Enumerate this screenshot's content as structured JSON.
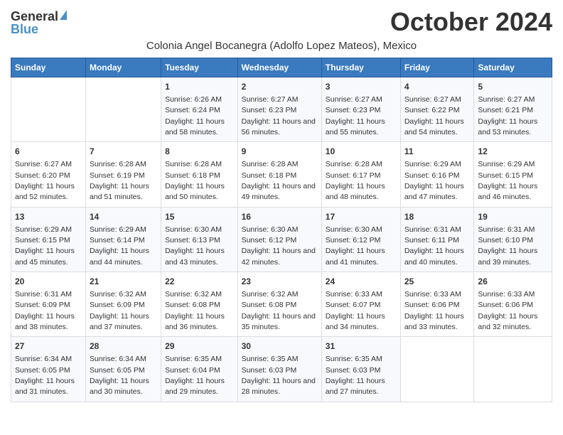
{
  "logo": {
    "general": "General",
    "blue": "Blue"
  },
  "title": "October 2024",
  "subtitle": "Colonia Angel Bocanegra (Adolfo Lopez Mateos), Mexico",
  "days_of_week": [
    "Sunday",
    "Monday",
    "Tuesday",
    "Wednesday",
    "Thursday",
    "Friday",
    "Saturday"
  ],
  "weeks": [
    [
      {
        "day": "",
        "info": ""
      },
      {
        "day": "",
        "info": ""
      },
      {
        "day": "1",
        "info": "Sunrise: 6:26 AM\nSunset: 6:24 PM\nDaylight: 11 hours and 58 minutes."
      },
      {
        "day": "2",
        "info": "Sunrise: 6:27 AM\nSunset: 6:23 PM\nDaylight: 11 hours and 56 minutes."
      },
      {
        "day": "3",
        "info": "Sunrise: 6:27 AM\nSunset: 6:23 PM\nDaylight: 11 hours and 55 minutes."
      },
      {
        "day": "4",
        "info": "Sunrise: 6:27 AM\nSunset: 6:22 PM\nDaylight: 11 hours and 54 minutes."
      },
      {
        "day": "5",
        "info": "Sunrise: 6:27 AM\nSunset: 6:21 PM\nDaylight: 11 hours and 53 minutes."
      }
    ],
    [
      {
        "day": "6",
        "info": "Sunrise: 6:27 AM\nSunset: 6:20 PM\nDaylight: 11 hours and 52 minutes."
      },
      {
        "day": "7",
        "info": "Sunrise: 6:28 AM\nSunset: 6:19 PM\nDaylight: 11 hours and 51 minutes."
      },
      {
        "day": "8",
        "info": "Sunrise: 6:28 AM\nSunset: 6:18 PM\nDaylight: 11 hours and 50 minutes."
      },
      {
        "day": "9",
        "info": "Sunrise: 6:28 AM\nSunset: 6:18 PM\nDaylight: 11 hours and 49 minutes."
      },
      {
        "day": "10",
        "info": "Sunrise: 6:28 AM\nSunset: 6:17 PM\nDaylight: 11 hours and 48 minutes."
      },
      {
        "day": "11",
        "info": "Sunrise: 6:29 AM\nSunset: 6:16 PM\nDaylight: 11 hours and 47 minutes."
      },
      {
        "day": "12",
        "info": "Sunrise: 6:29 AM\nSunset: 6:15 PM\nDaylight: 11 hours and 46 minutes."
      }
    ],
    [
      {
        "day": "13",
        "info": "Sunrise: 6:29 AM\nSunset: 6:15 PM\nDaylight: 11 hours and 45 minutes."
      },
      {
        "day": "14",
        "info": "Sunrise: 6:29 AM\nSunset: 6:14 PM\nDaylight: 11 hours and 44 minutes."
      },
      {
        "day": "15",
        "info": "Sunrise: 6:30 AM\nSunset: 6:13 PM\nDaylight: 11 hours and 43 minutes."
      },
      {
        "day": "16",
        "info": "Sunrise: 6:30 AM\nSunset: 6:12 PM\nDaylight: 11 hours and 42 minutes."
      },
      {
        "day": "17",
        "info": "Sunrise: 6:30 AM\nSunset: 6:12 PM\nDaylight: 11 hours and 41 minutes."
      },
      {
        "day": "18",
        "info": "Sunrise: 6:31 AM\nSunset: 6:11 PM\nDaylight: 11 hours and 40 minutes."
      },
      {
        "day": "19",
        "info": "Sunrise: 6:31 AM\nSunset: 6:10 PM\nDaylight: 11 hours and 39 minutes."
      }
    ],
    [
      {
        "day": "20",
        "info": "Sunrise: 6:31 AM\nSunset: 6:09 PM\nDaylight: 11 hours and 38 minutes."
      },
      {
        "day": "21",
        "info": "Sunrise: 6:32 AM\nSunset: 6:09 PM\nDaylight: 11 hours and 37 minutes."
      },
      {
        "day": "22",
        "info": "Sunrise: 6:32 AM\nSunset: 6:08 PM\nDaylight: 11 hours and 36 minutes."
      },
      {
        "day": "23",
        "info": "Sunrise: 6:32 AM\nSunset: 6:08 PM\nDaylight: 11 hours and 35 minutes."
      },
      {
        "day": "24",
        "info": "Sunrise: 6:33 AM\nSunset: 6:07 PM\nDaylight: 11 hours and 34 minutes."
      },
      {
        "day": "25",
        "info": "Sunrise: 6:33 AM\nSunset: 6:06 PM\nDaylight: 11 hours and 33 minutes."
      },
      {
        "day": "26",
        "info": "Sunrise: 6:33 AM\nSunset: 6:06 PM\nDaylight: 11 hours and 32 minutes."
      }
    ],
    [
      {
        "day": "27",
        "info": "Sunrise: 6:34 AM\nSunset: 6:05 PM\nDaylight: 11 hours and 31 minutes."
      },
      {
        "day": "28",
        "info": "Sunrise: 6:34 AM\nSunset: 6:05 PM\nDaylight: 11 hours and 30 minutes."
      },
      {
        "day": "29",
        "info": "Sunrise: 6:35 AM\nSunset: 6:04 PM\nDaylight: 11 hours and 29 minutes."
      },
      {
        "day": "30",
        "info": "Sunrise: 6:35 AM\nSunset: 6:03 PM\nDaylight: 11 hours and 28 minutes."
      },
      {
        "day": "31",
        "info": "Sunrise: 6:35 AM\nSunset: 6:03 PM\nDaylight: 11 hours and 27 minutes."
      },
      {
        "day": "",
        "info": ""
      },
      {
        "day": "",
        "info": ""
      }
    ]
  ]
}
